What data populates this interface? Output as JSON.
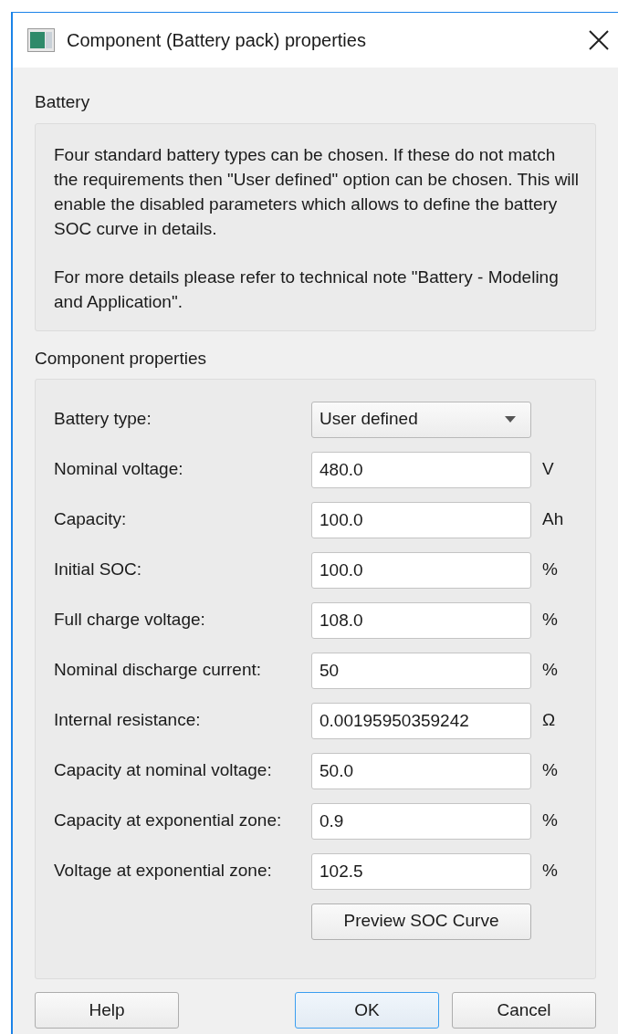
{
  "window": {
    "title": "Component (Battery pack) properties"
  },
  "battery_section": {
    "title": "Battery",
    "paragraphs": [
      "Four standard battery types can be chosen. If these do not match the requirements then \"User defined\" option can be chosen. This will enable the disabled parameters which allows to define the battery SOC curve in details.",
      "For more details please refer to technical note \"Battery - Modeling and Application\"."
    ]
  },
  "properties_section": {
    "title": "Component properties",
    "rows": [
      {
        "kind": "dropdown",
        "label": "Battery type:",
        "value": "User defined"
      },
      {
        "kind": "input",
        "label": "Nominal voltage:",
        "value": "480.0",
        "unit": "V"
      },
      {
        "kind": "input",
        "label": "Capacity:",
        "value": "100.0",
        "unit": "Ah"
      },
      {
        "kind": "input",
        "label": "Initial SOC:",
        "value": "100.0",
        "unit": "%"
      },
      {
        "kind": "input",
        "label": "Full charge voltage:",
        "value": "108.0",
        "unit": "%"
      },
      {
        "kind": "input",
        "label": "Nominal discharge current:",
        "value": "50",
        "unit": "%"
      },
      {
        "kind": "input",
        "label": "Internal resistance:",
        "value": "0.00195950359242",
        "unit": "Ω"
      },
      {
        "kind": "input",
        "label": "Capacity at nominal voltage:",
        "value": "50.0",
        "unit": "%"
      },
      {
        "kind": "input",
        "label": "Capacity at exponential zone:",
        "value": "0.9",
        "unit": "%"
      },
      {
        "kind": "input",
        "label": "Voltage at exponential zone:",
        "value": "102.5",
        "unit": "%"
      },
      {
        "kind": "button",
        "label": "Preview SOC Curve"
      }
    ]
  },
  "buttons": [
    {
      "label": "Help",
      "default": false
    },
    {
      "label": "OK",
      "default": true
    },
    {
      "label": "Cancel",
      "default": false
    }
  ]
}
